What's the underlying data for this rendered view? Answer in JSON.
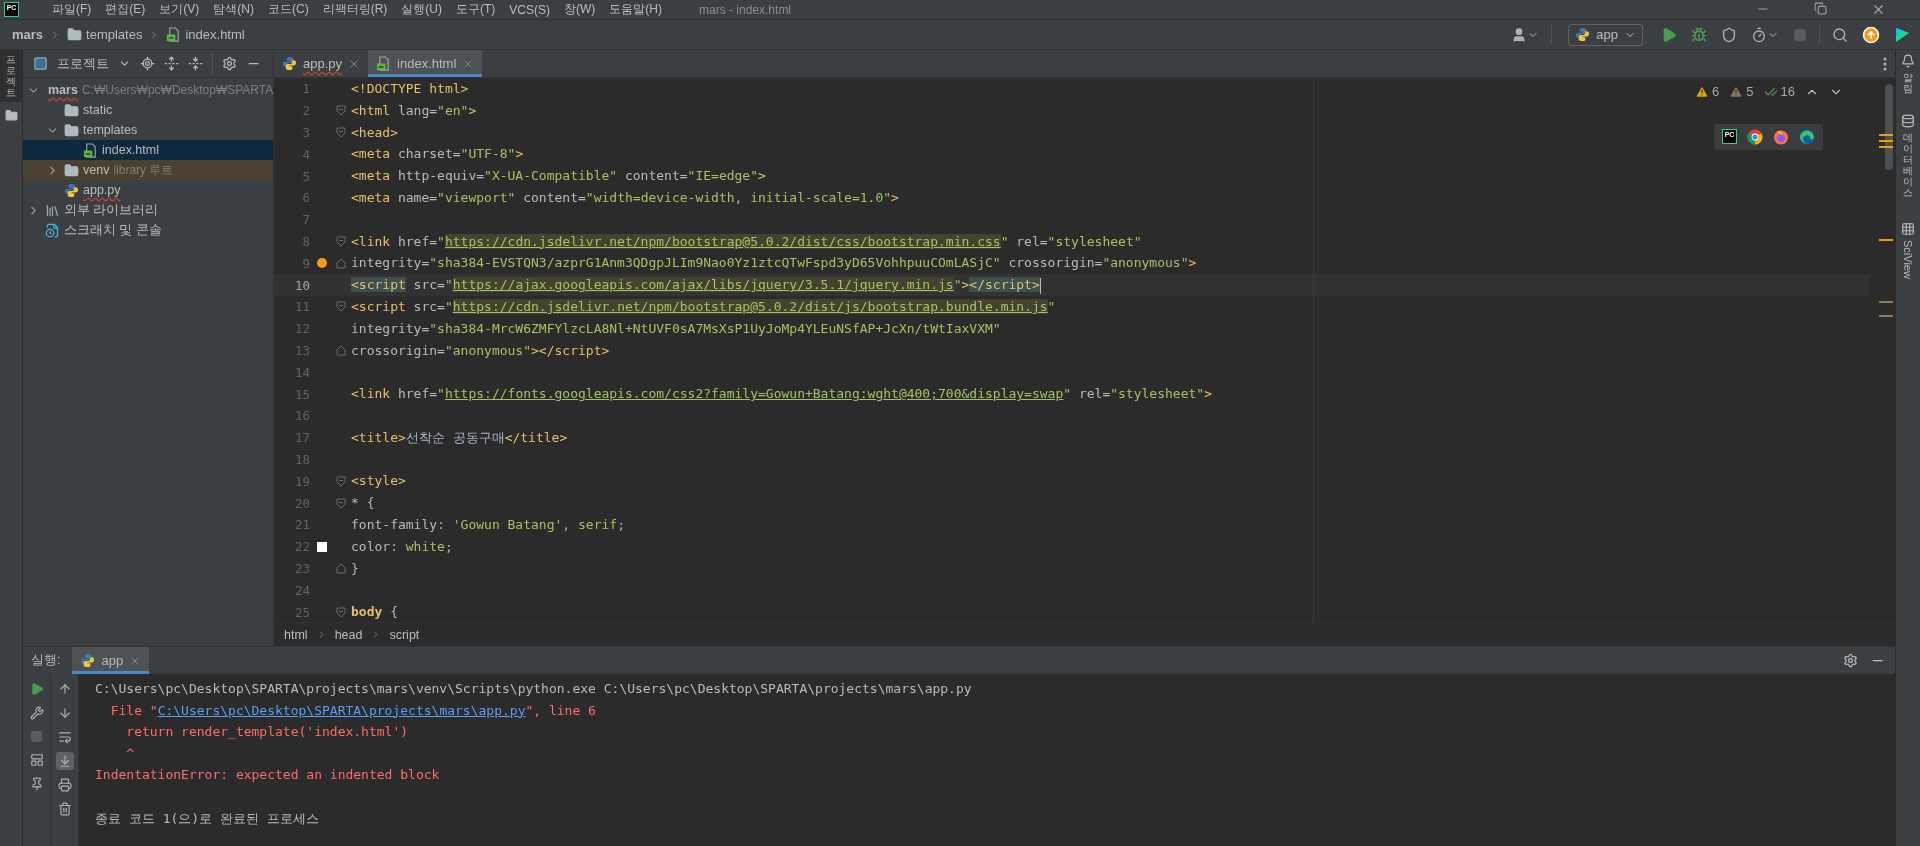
{
  "app_logo": "PC",
  "menu": [
    "파일(F)",
    "편집(E)",
    "보기(V)",
    "탐색(N)",
    "코드(C)",
    "리팩터링(R)",
    "실행(U)",
    "도구(T)",
    "VCS(S)",
    "창(W)",
    "도움말(H)"
  ],
  "window": {
    "title": "mars - index.html"
  },
  "breadcrumb": [
    {
      "label": "mars",
      "kind": "project"
    },
    {
      "label": "templates",
      "kind": "folder"
    },
    {
      "label": "index.html",
      "kind": "html"
    }
  ],
  "toolbar": [
    {
      "kind": "vcs-user",
      "disabled": false
    },
    {
      "kind": "run-config",
      "label": "app",
      "disabled": false
    },
    {
      "kind": "run",
      "disabled": false
    },
    {
      "kind": "debug",
      "disabled": false
    },
    {
      "kind": "coverage",
      "disabled": false
    },
    {
      "kind": "profile",
      "disabled": false
    },
    {
      "kind": "stop",
      "disabled": true
    },
    {
      "kind": "search",
      "disabled": false
    },
    {
      "kind": "update",
      "disabled": false
    },
    {
      "kind": "toolbox",
      "disabled": false
    }
  ],
  "left_stripe": [
    {
      "label": "프로젝트",
      "selected": true
    }
  ],
  "project": {
    "title": "프로젝트",
    "tree": [
      {
        "label": "mars",
        "hint": "C:₩Users₩pc₩Desktop₩SPARTA",
        "kind": "folder",
        "expanded": true,
        "selected": false,
        "tinted": false,
        "error": true,
        "children": [
          {
            "label": "static",
            "kind": "folder",
            "selected": false,
            "tinted": false,
            "error": false
          },
          {
            "label": "templates",
            "kind": "folder",
            "expanded": true,
            "selected": false,
            "tinted": false,
            "error": false,
            "children": [
              {
                "label": "index.html",
                "kind": "html",
                "selected": true,
                "tinted": false,
                "error": false
              }
            ]
          },
          {
            "label": "venv",
            "hint": "library 루트",
            "kind": "folder",
            "expanded": false,
            "selected": false,
            "tinted": true,
            "error": false
          },
          {
            "label": "app.py",
            "kind": "python",
            "selected": false,
            "tinted": false,
            "error": true
          }
        ]
      },
      {
        "label": "외부 라이브러리",
        "kind": "library",
        "expanded": false,
        "selected": false,
        "tinted": false,
        "error": false
      },
      {
        "label": "스크래치 및 콘솔",
        "kind": "scratch",
        "selected": false,
        "tinted": false,
        "error": false
      }
    ]
  },
  "editor": {
    "tabs": [
      {
        "label": "app.py",
        "kind": "python",
        "selected": false,
        "error": true
      },
      {
        "label": "index.html",
        "kind": "html",
        "selected": true,
        "error": false
      }
    ],
    "inspections": [
      {
        "kind": "warning",
        "count": "6"
      },
      {
        "kind": "weak",
        "count": "5"
      },
      {
        "kind": "typo",
        "count": "16"
      }
    ],
    "browsers": [
      {
        "kind": "pycharm",
        "text": "PC"
      },
      {
        "kind": "chrome"
      },
      {
        "kind": "firefox"
      },
      {
        "kind": "edge"
      }
    ],
    "lines": [
      {
        "number": "1",
        "current": false,
        "tokens": [
          {
            "kind": "tag",
            "text": "<!DOCTYPE html>"
          }
        ]
      },
      {
        "number": "2",
        "current": false,
        "markers": [
          {
            "kind": "fold-start"
          }
        ],
        "tokens": [
          {
            "kind": "tag",
            "text": "<html"
          },
          {
            "kind": "attr",
            "text": " lang="
          },
          {
            "kind": "str",
            "text": "\"en\""
          },
          {
            "kind": "tag",
            "text": ">"
          }
        ]
      },
      {
        "number": "3",
        "current": false,
        "markers": [
          {
            "kind": "fold-start"
          }
        ],
        "tokens": [
          {
            "kind": "tag",
            "text": "<head>"
          }
        ]
      },
      {
        "number": "4",
        "current": false,
        "tokens": [
          {
            "kind": "tag",
            "text": "<meta"
          },
          {
            "kind": "attr",
            "text": " charset="
          },
          {
            "kind": "str",
            "text": "\"UTF-8\""
          },
          {
            "kind": "tag",
            "text": ">"
          }
        ]
      },
      {
        "number": "5",
        "current": false,
        "tokens": [
          {
            "kind": "tag",
            "text": "<meta"
          },
          {
            "kind": "attr",
            "text": " http-equiv="
          },
          {
            "kind": "str",
            "text": "\"X-UA-Compatible\""
          },
          {
            "kind": "attr",
            "text": " content="
          },
          {
            "kind": "str",
            "text": "\"IE=edge\""
          },
          {
            "kind": "tag",
            "text": ">"
          }
        ]
      },
      {
        "number": "6",
        "current": false,
        "tokens": [
          {
            "kind": "tag",
            "text": "<meta"
          },
          {
            "kind": "attr",
            "text": " name="
          },
          {
            "kind": "str",
            "text": "\"viewport\""
          },
          {
            "kind": "attr",
            "text": " content="
          },
          {
            "kind": "str",
            "text": "\"width=device-width, initial-scale=1.0\""
          },
          {
            "kind": "tag",
            "text": ">"
          }
        ]
      },
      {
        "number": "7",
        "current": false
      },
      {
        "number": "8",
        "current": false,
        "markers": [
          {
            "kind": "fold-start"
          }
        ],
        "tokens": [
          {
            "kind": "tag",
            "text": "<link"
          },
          {
            "kind": "attr",
            "text": " href="
          },
          {
            "kind": "str",
            "text": "\""
          },
          {
            "kind": "url",
            "text": "https://cdn.jsdelivr.net/npm/bootstrap@5.0.2/dist/css/bootstrap.min.css"
          },
          {
            "kind": "str",
            "text": "\""
          },
          {
            "kind": "attr",
            "text": " rel="
          },
          {
            "kind": "str",
            "text": "\"stylesheet\""
          }
        ]
      },
      {
        "number": "9",
        "current": false,
        "markers": [
          {
            "kind": "bulb"
          },
          {
            "kind": "fold-end"
          }
        ],
        "tokens": [
          {
            "kind": "attr",
            "text": "integrity="
          },
          {
            "kind": "str",
            "text": "\"sha384-EVSTQN3/azprG1Anm3QDgpJLIm9Nao0Yz1ztcQTwFspd3yD65VohhpuuCOmLASjC\""
          },
          {
            "kind": "attr",
            "text": " crossorigin="
          },
          {
            "kind": "str",
            "text": "\"anonymous\""
          },
          {
            "kind": "tag",
            "text": ">"
          }
        ]
      },
      {
        "number": "10",
        "current": true,
        "tokens": [
          {
            "kind": "match",
            "text": "<script"
          },
          {
            "kind": "attr",
            "text": " src="
          },
          {
            "kind": "str",
            "text": "\""
          },
          {
            "kind": "url",
            "text": "https://ajax.googleapis.com/ajax/libs/jquery/3.5.1/jquery.min.js"
          },
          {
            "kind": "str",
            "text": "\""
          },
          {
            "kind": "tag",
            "text": ">"
          },
          {
            "kind": "match",
            "text": "</script>"
          }
        ]
      },
      {
        "number": "11",
        "current": false,
        "markers": [
          {
            "kind": "fold-start"
          }
        ],
        "tokens": [
          {
            "kind": "tag",
            "text": "<script"
          },
          {
            "kind": "attr",
            "text": " src="
          },
          {
            "kind": "str",
            "text": "\""
          },
          {
            "kind": "url",
            "text": "https://cdn.jsdelivr.net/npm/bootstrap@5.0.2/dist/js/bootstrap.bundle.min.js"
          },
          {
            "kind": "str",
            "text": "\""
          }
        ]
      },
      {
        "number": "12",
        "current": false,
        "tokens": [
          {
            "kind": "attr",
            "text": "integrity="
          },
          {
            "kind": "str",
            "text": "\"sha384-MrcW6ZMFYlzcLA8Nl+NtUVF0sA7MsXsP1UyJoMp4YLEuNSfAP+JcXn/tWtIaxVXM\""
          }
        ]
      },
      {
        "number": "13",
        "current": false,
        "markers": [
          {
            "kind": "fold-end"
          }
        ],
        "tokens": [
          {
            "kind": "attr",
            "text": "crossorigin="
          },
          {
            "kind": "str",
            "text": "\"anonymous\""
          },
          {
            "kind": "tag",
            "text": "></script>"
          }
        ]
      },
      {
        "number": "14",
        "current": false
      },
      {
        "number": "15",
        "current": false,
        "tokens": [
          {
            "kind": "tag",
            "text": "<link"
          },
          {
            "kind": "attr",
            "text": " href="
          },
          {
            "kind": "str",
            "text": "\""
          },
          {
            "kind": "link",
            "text": "https://fonts.googleapis.com/css2?family=Gowun+Batang:wght@400;700&display=swap"
          },
          {
            "kind": "str",
            "text": "\""
          },
          {
            "kind": "attr",
            "text": " rel="
          },
          {
            "kind": "str",
            "text": "\"stylesheet\""
          },
          {
            "kind": "tag",
            "text": ">"
          }
        ]
      },
      {
        "number": "16",
        "current": false
      },
      {
        "number": "17",
        "current": false,
        "tokens": [
          {
            "kind": "tag",
            "text": "<title>"
          },
          {
            "kind": "text",
            "text": "선착순 공동구매"
          },
          {
            "kind": "tag",
            "text": "</title>"
          }
        ]
      },
      {
        "number": "18",
        "current": false
      },
      {
        "number": "19",
        "current": false,
        "markers": [
          {
            "kind": "fold-start"
          }
        ],
        "tokens": [
          {
            "kind": "tag",
            "text": "<style>"
          }
        ]
      },
      {
        "number": "20",
        "current": false,
        "markers": [
          {
            "kind": "fold-start"
          }
        ],
        "tokens": [
          {
            "kind": "text",
            "text": "* {"
          }
        ]
      },
      {
        "number": "21",
        "current": false,
        "tokens": [
          {
            "kind": "attr",
            "text": "font-family"
          },
          {
            "kind": "text",
            "text": ": "
          },
          {
            "kind": "str",
            "text": "'Gowun Batang', serif"
          },
          {
            "kind": "text",
            "text": ";"
          }
        ]
      },
      {
        "number": "22",
        "current": false,
        "markers": [
          {
            "kind": "swatch"
          }
        ],
        "tokens": [
          {
            "kind": "attr",
            "text": "color"
          },
          {
            "kind": "text",
            "text": ": "
          },
          {
            "kind": "str",
            "text": "white"
          },
          {
            "kind": "text",
            "text": ";"
          }
        ]
      },
      {
        "number": "23",
        "current": false,
        "markers": [
          {
            "kind": "fold-end"
          }
        ],
        "tokens": [
          {
            "kind": "text",
            "text": "}"
          }
        ]
      },
      {
        "number": "24",
        "current": false
      },
      {
        "number": "25",
        "current": false,
        "markers": [
          {
            "kind": "fold-start"
          }
        ],
        "tokens": [
          {
            "kind": "sel",
            "text": "body"
          },
          {
            "kind": "text",
            "text": " {"
          }
        ]
      }
    ],
    "path": [
      "html",
      "head",
      "script"
    ]
  },
  "right_stripe": [
    {
      "kind": "notifications",
      "label": "알림"
    },
    {
      "kind": "database",
      "label": "데이터베이스"
    },
    {
      "kind": "sciview",
      "label": "SciView"
    }
  ],
  "run": {
    "label": "실행:",
    "tab": "app",
    "tools": [
      {
        "kind": "rerun",
        "disabled": false
      },
      {
        "kind": "wrench",
        "disabled": false
      },
      {
        "kind": "stop",
        "disabled": true
      },
      {
        "kind": "layout",
        "disabled": false
      },
      {
        "kind": "pin",
        "disabled": false
      }
    ],
    "output_tools": [
      {
        "kind": "up",
        "selected": false
      },
      {
        "kind": "down",
        "selected": false
      },
      {
        "kind": "wrap",
        "selected": false
      },
      {
        "kind": "scroll-end",
        "selected": true
      },
      {
        "kind": "print",
        "selected": false
      },
      {
        "kind": "trash",
        "selected": false
      }
    ],
    "lines": [
      {
        "kind": "plain",
        "text": "C:\\Users\\pc\\Desktop\\SPARTA\\projects\\mars\\venv\\Scripts\\python.exe C:\\Users\\pc\\Desktop\\SPARTA\\projects\\mars\\app.py"
      },
      {
        "kind": "error",
        "text": "  File \"",
        "link": "C:\\Users\\pc\\Desktop\\SPARTA\\projects\\mars\\app.py",
        "after": "\", line 6"
      },
      {
        "kind": "error",
        "text": "    return render_template('index.html')"
      },
      {
        "kind": "error",
        "text": "    ^"
      },
      {
        "kind": "error",
        "text": "IndentationError: expected an indented block"
      },
      {
        "kind": "exit",
        "text": "종료 코드 1(으)로 완료된 프로세스"
      }
    ]
  }
}
